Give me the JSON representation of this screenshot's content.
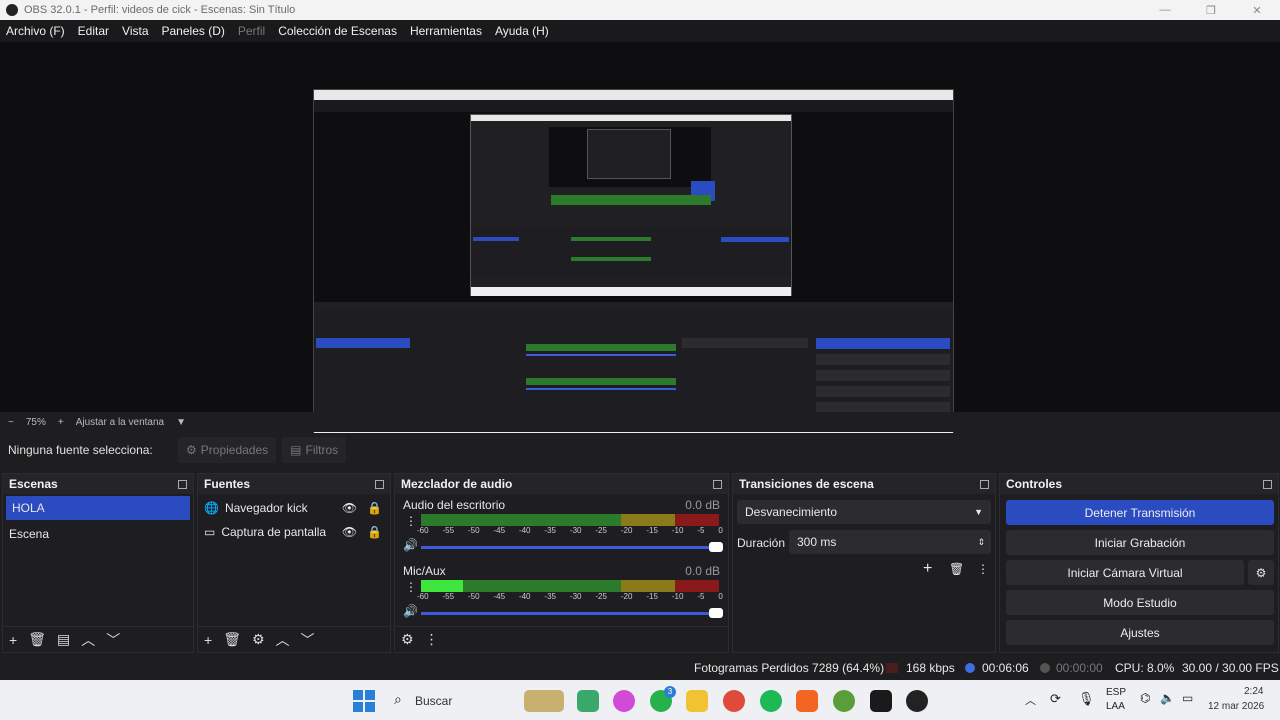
{
  "window": {
    "title": "OBS 32.0.1 - Perfil: videos de cick - Escenas: Sin Título"
  },
  "menu": [
    "Archivo (F)",
    "Editar",
    "Vista",
    "Paneles (D)",
    "Perfil",
    "Colección de Escenas",
    "Herramientas",
    "Ayuda (H)"
  ],
  "zoom": {
    "minus": "−",
    "value": "75%",
    "plus": "+",
    "fit": "Ajustar a la ventana"
  },
  "source_bar": {
    "none_selected": "Ninguna fuente selecciona:",
    "properties": "Propiedades",
    "filters": "Filtros"
  },
  "scenes": {
    "title": "Escenas",
    "items": [
      "HOLA",
      "Escena"
    ]
  },
  "sources": {
    "title": "Fuentes",
    "items": [
      "Navegador kick",
      "Captura de pantalla"
    ]
  },
  "mixer": {
    "title": "Mezclador de audio",
    "ticks": [
      "-60",
      "-55",
      "-50",
      "-45",
      "-40",
      "-35",
      "-30",
      "-25",
      "-20",
      "-15",
      "-10",
      "-5",
      "0"
    ],
    "channels": [
      {
        "name": "Audio del escritorio",
        "db": "0.0 dB",
        "level": 0.0
      },
      {
        "name": "Mic/Aux",
        "db": "0.0 dB",
        "level": 0.14
      }
    ]
  },
  "transitions": {
    "title": "Transiciones de escena",
    "selected": "Desvanecimiento",
    "duration_label": "Duración",
    "duration_value": "300 ms"
  },
  "controls": {
    "title": "Controles",
    "buttons": [
      "Detener Transmisión",
      "Iniciar Grabación",
      "Iniciar Cámara Virtual",
      "Modo Estudio",
      "Ajustes"
    ]
  },
  "status": {
    "dropped": "Fotogramas Perdidos 7289 (64.4%)",
    "kbps": "168 kbps",
    "live_time": "00:06:06",
    "rec_time": "00:00:00",
    "cpu": "CPU: 8.0%",
    "fps": "30.00 / 30.00 FPS"
  },
  "taskbar": {
    "search": "Buscar",
    "lang_top": "ESP",
    "lang_bottom": "LAA",
    "time": "2:24",
    "date": "12 mar 2026",
    "whatsapp_badge": "3"
  },
  "colors": {
    "accent": "#2b4bc0",
    "meter_green": "#2c7a2c",
    "meter_yellow": "#8a7a1a",
    "meter_red": "#8a1a1a"
  }
}
